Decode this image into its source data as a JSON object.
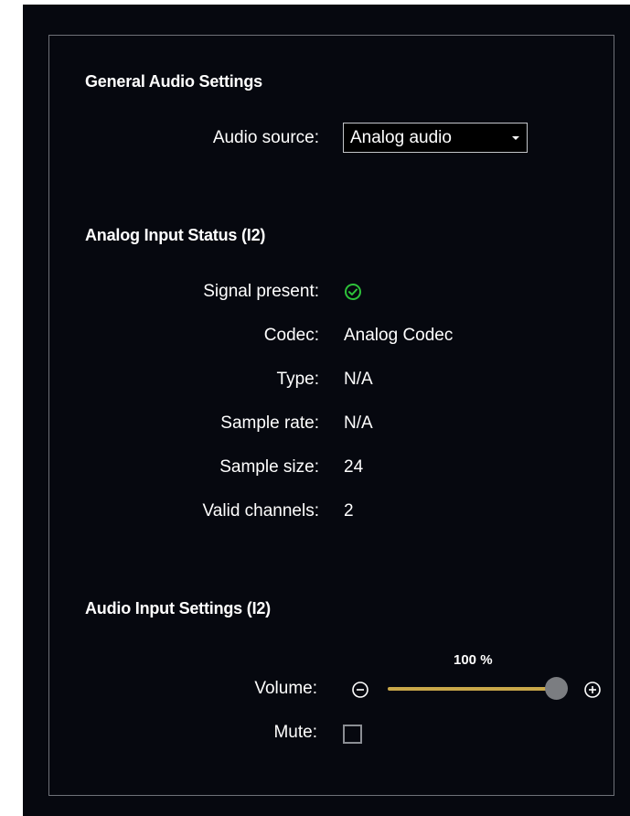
{
  "general": {
    "heading": "General Audio Settings",
    "audio_source_label": "Audio source:",
    "audio_source_value": "Analog audio"
  },
  "status": {
    "heading": "Analog Input Status (I2)",
    "signal_label": "Signal present:",
    "signal_icon": "check-circle-icon",
    "codec_label": "Codec:",
    "codec_value": "Analog Codec",
    "type_label": "Type:",
    "type_value": "N/A",
    "sample_rate_label": "Sample rate:",
    "sample_rate_value": "N/A",
    "sample_size_label": "Sample size:",
    "sample_size_value": "24",
    "valid_channels_label": "Valid channels:",
    "valid_channels_value": "2"
  },
  "input": {
    "heading": "Audio Input Settings (I2)",
    "volume_label": "Volume:",
    "volume_value": "100 %",
    "volume_level": 1.0,
    "mute_label": "Mute:",
    "mute_checked": false
  },
  "colors": {
    "background": "#06080f",
    "accent": "#c9a84a",
    "ok": "#2ec23a"
  }
}
